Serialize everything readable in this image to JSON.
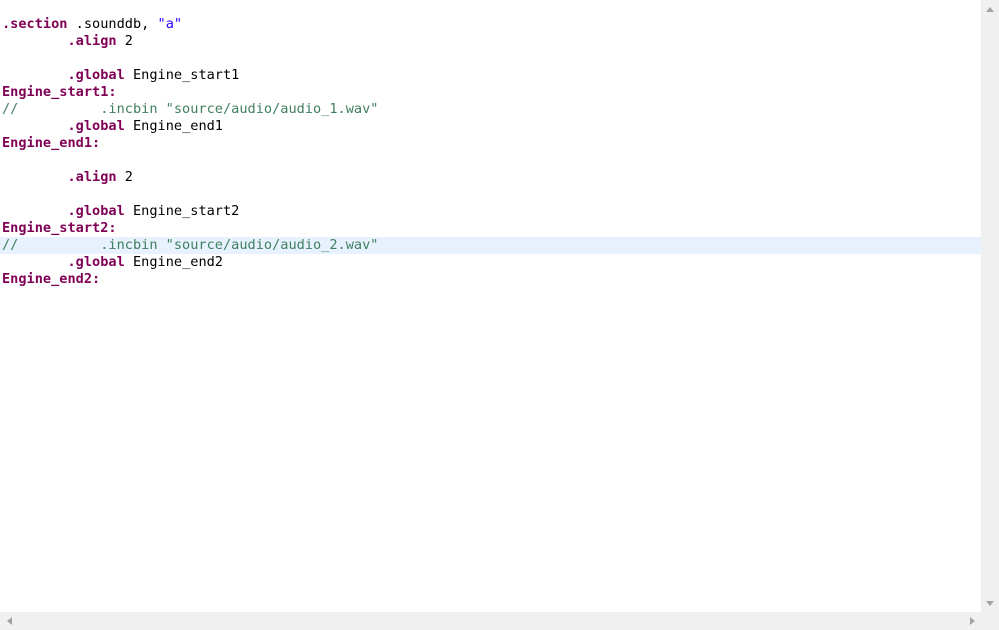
{
  "editor": {
    "lines": [
      {
        "segments": [
          {
            "t": ".section",
            "c": "kw"
          },
          {
            "t": " .sounddb, ",
            "c": "plain"
          },
          {
            "t": "\"a\"",
            "c": "str"
          }
        ]
      },
      {
        "segments": [
          {
            "t": "        ",
            "c": "plain"
          },
          {
            "t": ".align",
            "c": "kw"
          },
          {
            "t": " 2",
            "c": "plain"
          }
        ]
      },
      {
        "segments": []
      },
      {
        "segments": [
          {
            "t": "        ",
            "c": "plain"
          },
          {
            "t": ".global",
            "c": "kw"
          },
          {
            "t": " Engine_start1",
            "c": "plain"
          }
        ]
      },
      {
        "segments": [
          {
            "t": "Engine_start1:",
            "c": "lbl"
          }
        ]
      },
      {
        "segments": [
          {
            "t": "//          .incbin \"source/audio/audio_1.wav\"",
            "c": "cmt"
          }
        ]
      },
      {
        "segments": [
          {
            "t": "        ",
            "c": "plain"
          },
          {
            "t": ".global",
            "c": "kw"
          },
          {
            "t": " Engine_end1",
            "c": "plain"
          }
        ]
      },
      {
        "segments": [
          {
            "t": "Engine_end1:",
            "c": "lbl"
          }
        ]
      },
      {
        "segments": []
      },
      {
        "segments": [
          {
            "t": "        ",
            "c": "plain"
          },
          {
            "t": ".align",
            "c": "kw"
          },
          {
            "t": " 2",
            "c": "plain"
          }
        ]
      },
      {
        "segments": []
      },
      {
        "segments": [
          {
            "t": "        ",
            "c": "plain"
          },
          {
            "t": ".global",
            "c": "kw"
          },
          {
            "t": " Engine_start2",
            "c": "plain"
          }
        ]
      },
      {
        "segments": [
          {
            "t": "Engine_start2:",
            "c": "lbl"
          }
        ]
      },
      {
        "segments": [
          {
            "t": "//          .incbin \"source/audio/audio_2.wav\"",
            "c": "cmt"
          }
        ],
        "current": true
      },
      {
        "segments": [
          {
            "t": "        ",
            "c": "plain"
          },
          {
            "t": ".global",
            "c": "kw"
          },
          {
            "t": " Engine_end2",
            "c": "plain"
          }
        ]
      },
      {
        "segments": [
          {
            "t": "Engine_end2:",
            "c": "lbl"
          }
        ]
      }
    ]
  },
  "scrollbars": {
    "vertical": {
      "up_icon": "chevron-up-icon",
      "down_icon": "chevron-down-icon"
    },
    "horizontal": {
      "left_icon": "chevron-left-icon",
      "right_icon": "chevron-right-icon"
    }
  },
  "colors": {
    "keyword": "#7f0055",
    "string": "#2a00ff",
    "comment": "#3f7f5f",
    "current_line": "#e8f2fe",
    "scrollbar_track": "#f0f0f0"
  }
}
